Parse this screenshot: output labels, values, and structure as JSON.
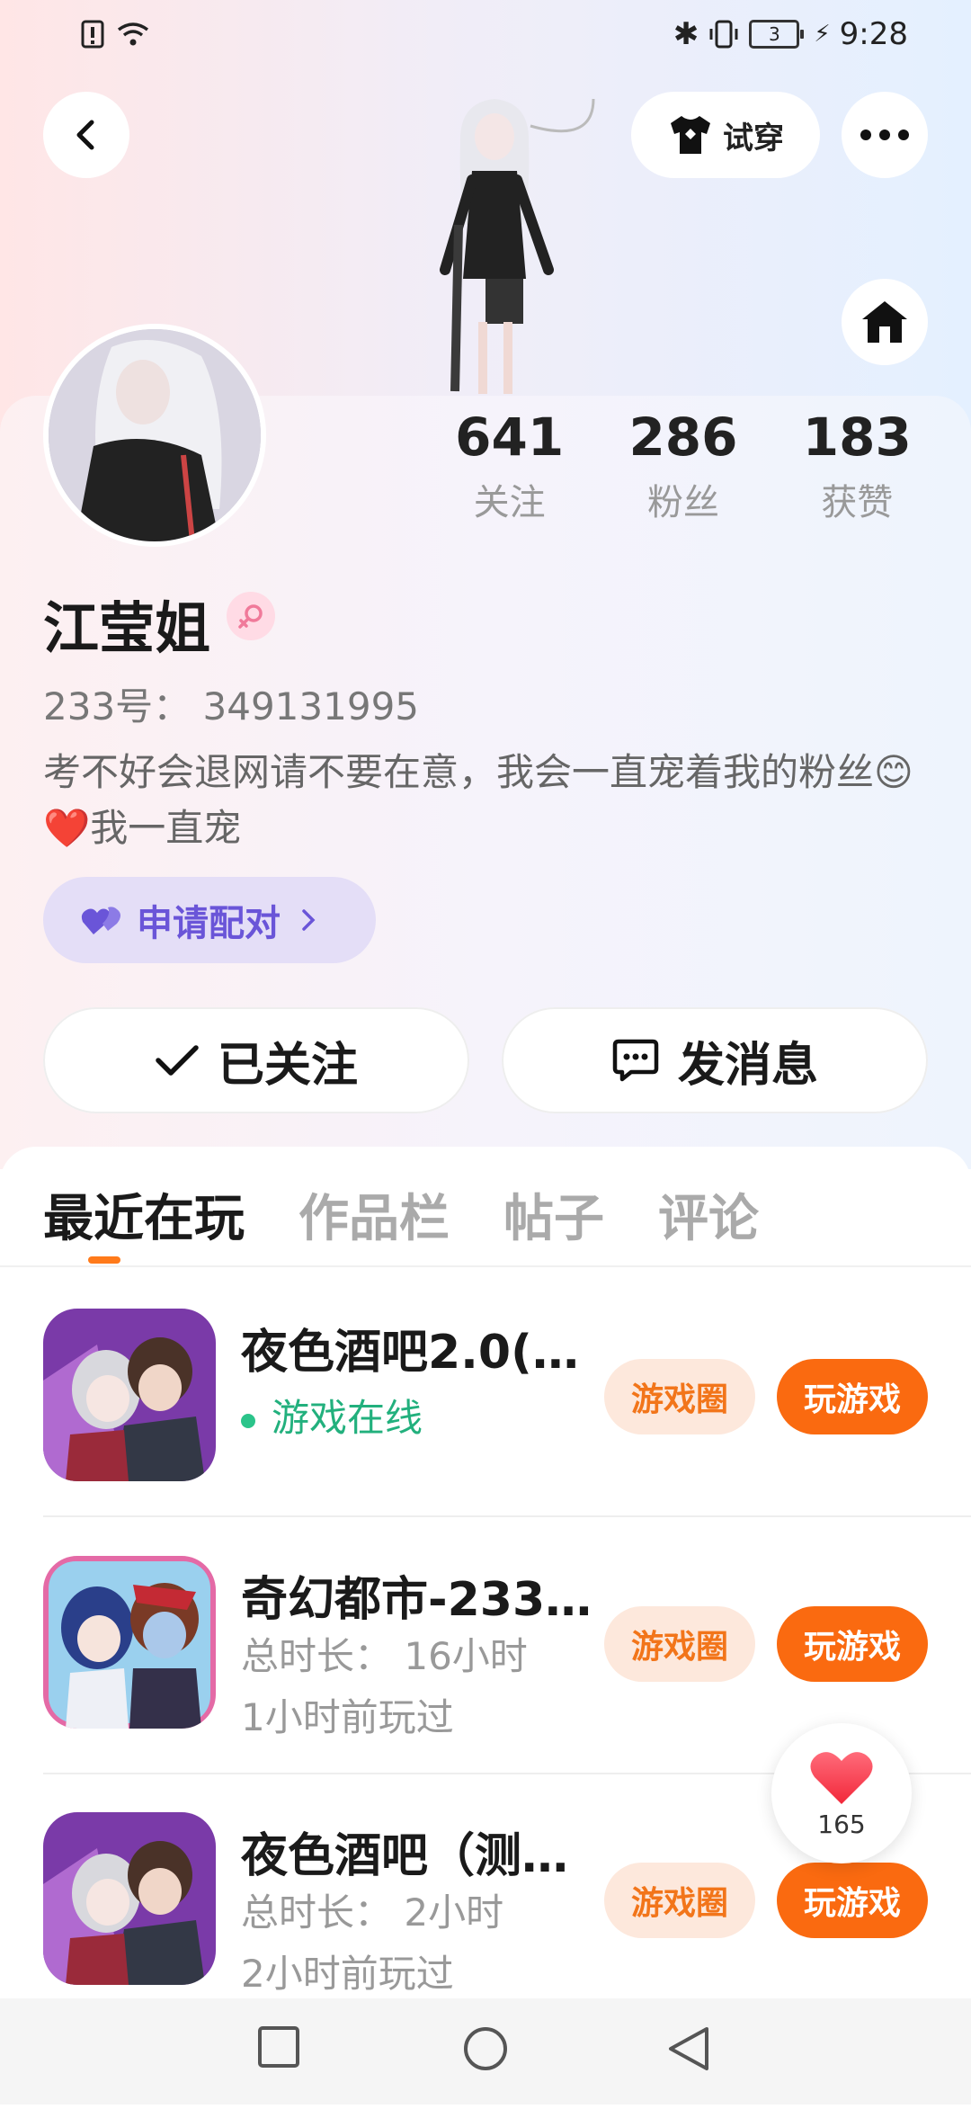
{
  "status_bar": {
    "time": "9:28",
    "battery": "3"
  },
  "header": {
    "try_on_label": "试穿"
  },
  "profile": {
    "stats": [
      {
        "value": "641",
        "label": "关注"
      },
      {
        "value": "286",
        "label": "粉丝"
      },
      {
        "value": "183",
        "label": "获赞"
      }
    ],
    "nickname": "江莹姐",
    "uid": "233号：  349131995",
    "bio": "考不好会退网请不要在意，我会一直宠着我的粉丝😊❤️我一直宠",
    "pair_label": "申请配对",
    "follow_label": "已关注",
    "message_label": "发消息"
  },
  "tabs": [
    "最近在玩",
    "作品栏",
    "帖子",
    "评论"
  ],
  "games": [
    {
      "name": "夜色酒吧2.0(…",
      "line1": "游戏在线",
      "line2": "",
      "online": true,
      "circle_label": "游戏圈",
      "play_label": "玩游戏",
      "icon": "anime-duo-icon"
    },
    {
      "name": "奇幻都市-233…",
      "line1": "总时长：  16小时",
      "line2": "1小时前玩过",
      "online": false,
      "circle_label": "游戏圈",
      "play_label": "玩游戏",
      "icon": "anime-girls-icon"
    },
    {
      "name": "夜色酒吧（测…",
      "line1": "总时长：  2小时",
      "line2": "2小时前玩过",
      "online": false,
      "circle_label": "游戏圈",
      "play_label": "玩游戏",
      "icon": "anime-duo-icon"
    }
  ],
  "like_button": {
    "count": "165"
  },
  "colors": {
    "accent_orange": "#fa6a10",
    "online_green": "#2bc48a",
    "pair_purple": "#6a55d8"
  }
}
